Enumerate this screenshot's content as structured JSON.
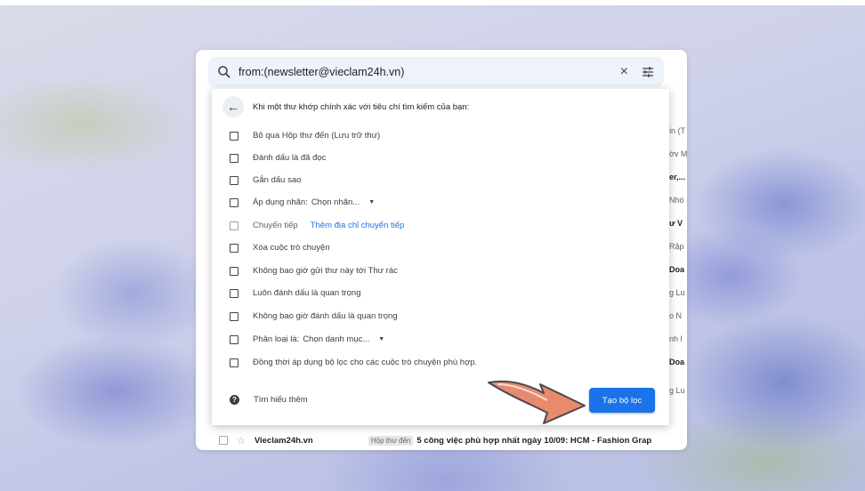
{
  "search": {
    "query": "from:(newsletter@vieclam24h.vn)",
    "close_icon": "×",
    "tune_icon": "⚟"
  },
  "dialog": {
    "title": "Khi một thư khớp chính xác với tiêu chí tìm kiếm của bạn:",
    "options": [
      {
        "label": "Bỏ qua Hộp thư đến (Lưu trữ thư)"
      },
      {
        "label": "Đánh dấu là đã đọc"
      },
      {
        "label": "Gắn dấu sao"
      },
      {
        "label": "Áp dụng nhãn:",
        "select": "Chọn nhãn..."
      },
      {
        "label": "Chuyển tiếp",
        "link": "Thêm địa chỉ chuyển tiếp"
      },
      {
        "label": "Xóa cuộc trò chuyện"
      },
      {
        "label": "Không bao giờ gửi thư này tới Thư rác"
      },
      {
        "label": "Luôn đánh dấu là quan trọng"
      },
      {
        "label": "Không bao giờ đánh dấu là quan trọng"
      },
      {
        "label": "Phân loại là:",
        "select": "Chọn danh mục..."
      },
      {
        "label": "Đồng thời áp dụng bộ lọc cho các cuộc trò chuyện phù hợp."
      }
    ],
    "help_label": "Tìm hiểu thêm",
    "create_label": "Tạo bộ lọc"
  },
  "background_list": {
    "peeks": [
      "in (T",
      "ờv M",
      "er,...",
      "Nhó",
      "ư V",
      "Rập",
      "Doa",
      "g Lu",
      "o N",
      "nh l",
      "Doa",
      "g Lu"
    ],
    "bottom_row": {
      "sender": "Vieclam24h.vn",
      "label": "Hộp thư đến",
      "subject": "5 công việc phù hợp nhất ngày 10/09: HCM - Fashion Grap"
    }
  },
  "colors": {
    "accent": "#1a73e8",
    "arrow_fill": "#e88a6e",
    "arrow_stroke": "#4a4a4a"
  }
}
